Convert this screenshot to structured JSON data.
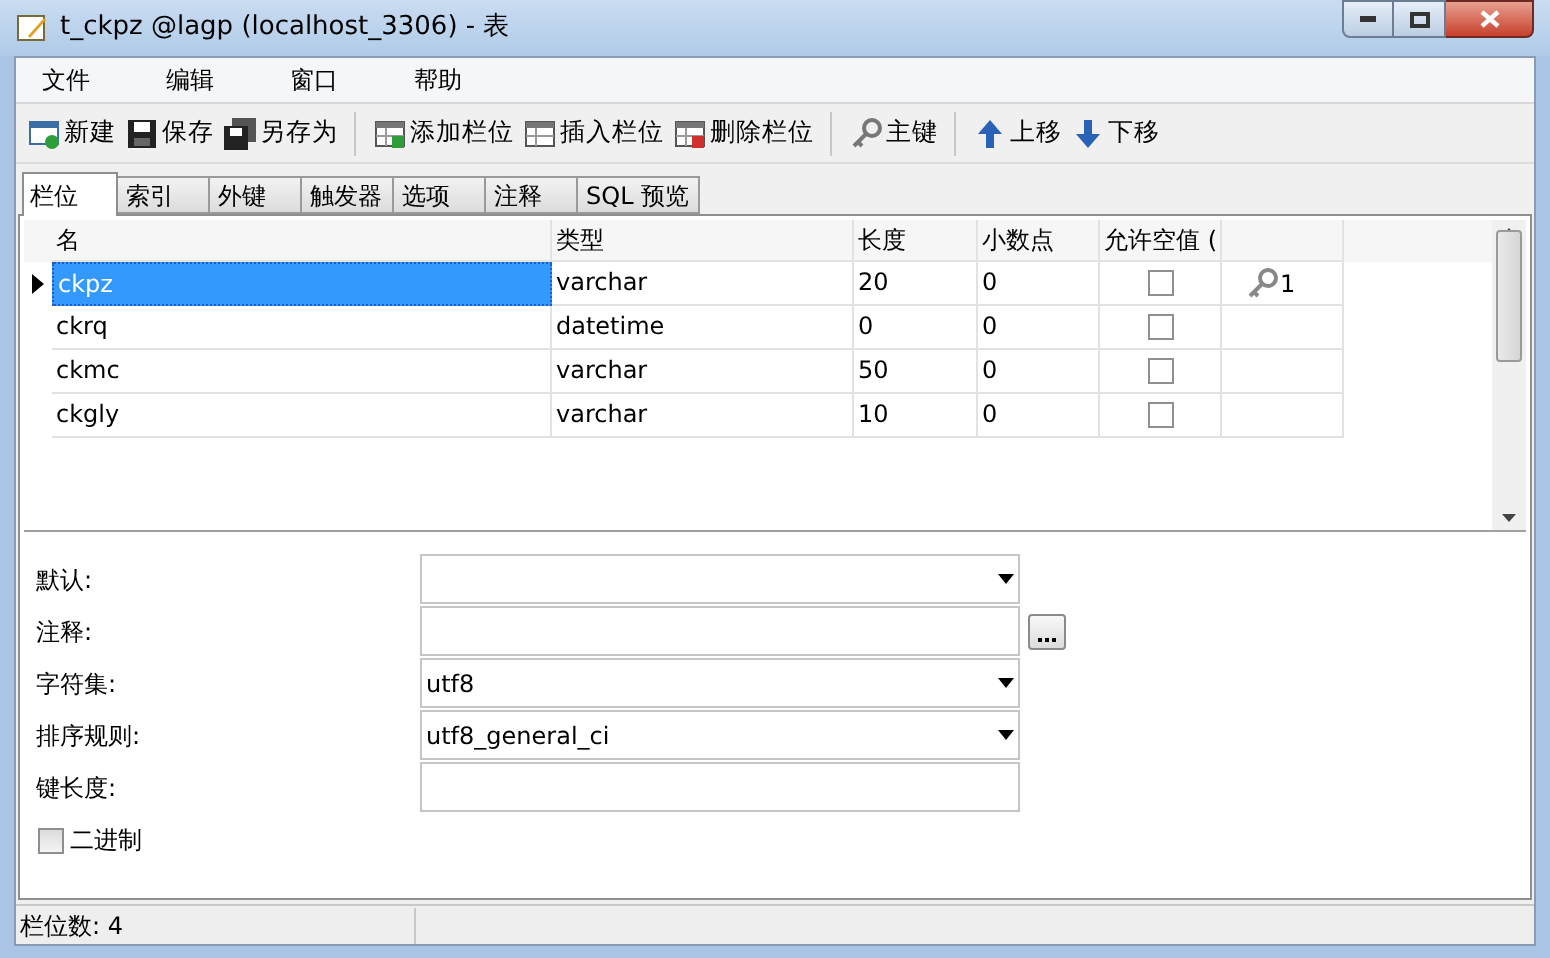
{
  "window": {
    "title": "t_ckpz @lagp (localhost_3306) - 表"
  },
  "menu": [
    "文件",
    "编辑",
    "窗口",
    "帮助"
  ],
  "toolbar_groups": [
    [
      {
        "kind": "new",
        "label": "新建"
      },
      {
        "kind": "save",
        "label": "保存"
      },
      {
        "kind": "saveas",
        "label": "另存为"
      }
    ],
    [
      {
        "kind": "add",
        "label": "添加栏位"
      },
      {
        "kind": "insert",
        "label": "插入栏位"
      },
      {
        "kind": "delete",
        "label": "删除栏位"
      }
    ],
    [
      {
        "kind": "key",
        "label": "主键"
      }
    ],
    [
      {
        "kind": "up",
        "label": "上移"
      },
      {
        "kind": "down",
        "label": "下移"
      }
    ]
  ],
  "tabs": [
    {
      "label": "栏位",
      "selected": true
    },
    {
      "label": "索引",
      "selected": false
    },
    {
      "label": "外键",
      "selected": false
    },
    {
      "label": "触发器",
      "selected": false
    },
    {
      "label": "选项",
      "selected": false
    },
    {
      "label": "注释",
      "selected": false
    },
    {
      "label": "SQL 预览",
      "selected": false
    }
  ],
  "grid": {
    "columns": [
      "名",
      "类型",
      "长度",
      "小数点",
      "允许空值 ("
    ],
    "rows": [
      {
        "name": "ckpz",
        "type": "varchar",
        "length": "20",
        "decimals": "0",
        "allow_null": false,
        "key": "1",
        "selected": true
      },
      {
        "name": "ckrq",
        "type": "datetime",
        "length": "0",
        "decimals": "0",
        "allow_null": false,
        "selected": false
      },
      {
        "name": "ckmc",
        "type": "varchar",
        "length": "50",
        "decimals": "0",
        "allow_null": false,
        "selected": false
      },
      {
        "name": "ckgly",
        "type": "varchar",
        "length": "10",
        "decimals": "0",
        "allow_null": false,
        "selected": false
      }
    ]
  },
  "properties": [
    {
      "label": "默认:",
      "kind": "dropdown"
    },
    {
      "label": "注释:",
      "kind": "text_button"
    },
    {
      "label": "字符集:",
      "kind": "dropdown",
      "value": "utf8"
    },
    {
      "label": "排序规则:",
      "kind": "dropdown",
      "value": "utf8_general_ci"
    },
    {
      "label": "键长度:",
      "kind": "text"
    }
  ],
  "binary": {
    "label": "二进制",
    "checked": false
  },
  "status_bar": "栏位数: 4"
}
